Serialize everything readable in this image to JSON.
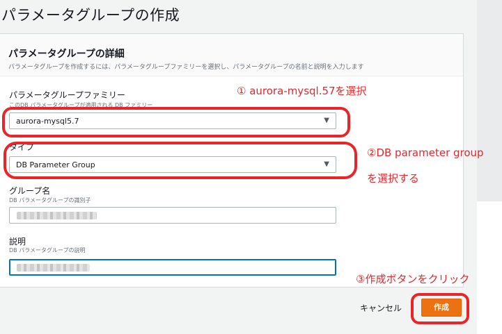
{
  "page": {
    "title": "パラメータグループの作成"
  },
  "panel": {
    "title": "パラメータグループの詳細",
    "description": "パラメータグループを作成するには、パラメータグループファミリーを選択し、パラメータグループの名前と説明を入力します"
  },
  "fields": {
    "family": {
      "label": "パラメータグループファミリー",
      "description": "このDB パラメータグループが適用される DB ファミリー",
      "value": "aurora-mysql5.7"
    },
    "type": {
      "label": "タイプ",
      "value": "DB Parameter Group"
    },
    "group_name": {
      "label": "グループ名",
      "description": "DB パラメータグループの識別子"
    },
    "description": {
      "label": "説明",
      "description": "DB パラメータグループの説明"
    }
  },
  "footer": {
    "cancel_label": "キャンセル",
    "create_label": "作成"
  },
  "annotations": {
    "step1": "① aurora-mysql.57を選択",
    "step2_line1": "②DB parameter group",
    "step2_line2": "を選択する",
    "step3": "③作成ボタンをクリック"
  },
  "colors": {
    "accent": "#ec7211",
    "annotation": "#e8262a",
    "focus": "#0073bb"
  }
}
